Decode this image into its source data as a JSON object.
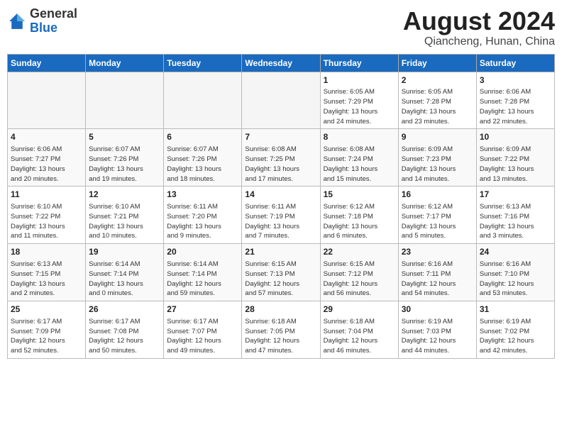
{
  "header": {
    "logo_general": "General",
    "logo_blue": "Blue",
    "title": "August 2024",
    "subtitle": "Qiancheng, Hunan, China"
  },
  "weekdays": [
    "Sunday",
    "Monday",
    "Tuesday",
    "Wednesday",
    "Thursday",
    "Friday",
    "Saturday"
  ],
  "weeks": [
    [
      {
        "day": "",
        "info": ""
      },
      {
        "day": "",
        "info": ""
      },
      {
        "day": "",
        "info": ""
      },
      {
        "day": "",
        "info": ""
      },
      {
        "day": "1",
        "info": "Sunrise: 6:05 AM\nSunset: 7:29 PM\nDaylight: 13 hours\nand 24 minutes."
      },
      {
        "day": "2",
        "info": "Sunrise: 6:05 AM\nSunset: 7:28 PM\nDaylight: 13 hours\nand 23 minutes."
      },
      {
        "day": "3",
        "info": "Sunrise: 6:06 AM\nSunset: 7:28 PM\nDaylight: 13 hours\nand 22 minutes."
      }
    ],
    [
      {
        "day": "4",
        "info": "Sunrise: 6:06 AM\nSunset: 7:27 PM\nDaylight: 13 hours\nand 20 minutes."
      },
      {
        "day": "5",
        "info": "Sunrise: 6:07 AM\nSunset: 7:26 PM\nDaylight: 13 hours\nand 19 minutes."
      },
      {
        "day": "6",
        "info": "Sunrise: 6:07 AM\nSunset: 7:26 PM\nDaylight: 13 hours\nand 18 minutes."
      },
      {
        "day": "7",
        "info": "Sunrise: 6:08 AM\nSunset: 7:25 PM\nDaylight: 13 hours\nand 17 minutes."
      },
      {
        "day": "8",
        "info": "Sunrise: 6:08 AM\nSunset: 7:24 PM\nDaylight: 13 hours\nand 15 minutes."
      },
      {
        "day": "9",
        "info": "Sunrise: 6:09 AM\nSunset: 7:23 PM\nDaylight: 13 hours\nand 14 minutes."
      },
      {
        "day": "10",
        "info": "Sunrise: 6:09 AM\nSunset: 7:22 PM\nDaylight: 13 hours\nand 13 minutes."
      }
    ],
    [
      {
        "day": "11",
        "info": "Sunrise: 6:10 AM\nSunset: 7:22 PM\nDaylight: 13 hours\nand 11 minutes."
      },
      {
        "day": "12",
        "info": "Sunrise: 6:10 AM\nSunset: 7:21 PM\nDaylight: 13 hours\nand 10 minutes."
      },
      {
        "day": "13",
        "info": "Sunrise: 6:11 AM\nSunset: 7:20 PM\nDaylight: 13 hours\nand 9 minutes."
      },
      {
        "day": "14",
        "info": "Sunrise: 6:11 AM\nSunset: 7:19 PM\nDaylight: 13 hours\nand 7 minutes."
      },
      {
        "day": "15",
        "info": "Sunrise: 6:12 AM\nSunset: 7:18 PM\nDaylight: 13 hours\nand 6 minutes."
      },
      {
        "day": "16",
        "info": "Sunrise: 6:12 AM\nSunset: 7:17 PM\nDaylight: 13 hours\nand 5 minutes."
      },
      {
        "day": "17",
        "info": "Sunrise: 6:13 AM\nSunset: 7:16 PM\nDaylight: 13 hours\nand 3 minutes."
      }
    ],
    [
      {
        "day": "18",
        "info": "Sunrise: 6:13 AM\nSunset: 7:15 PM\nDaylight: 13 hours\nand 2 minutes."
      },
      {
        "day": "19",
        "info": "Sunrise: 6:14 AM\nSunset: 7:14 PM\nDaylight: 13 hours\nand 0 minutes."
      },
      {
        "day": "20",
        "info": "Sunrise: 6:14 AM\nSunset: 7:14 PM\nDaylight: 12 hours\nand 59 minutes."
      },
      {
        "day": "21",
        "info": "Sunrise: 6:15 AM\nSunset: 7:13 PM\nDaylight: 12 hours\nand 57 minutes."
      },
      {
        "day": "22",
        "info": "Sunrise: 6:15 AM\nSunset: 7:12 PM\nDaylight: 12 hours\nand 56 minutes."
      },
      {
        "day": "23",
        "info": "Sunrise: 6:16 AM\nSunset: 7:11 PM\nDaylight: 12 hours\nand 54 minutes."
      },
      {
        "day": "24",
        "info": "Sunrise: 6:16 AM\nSunset: 7:10 PM\nDaylight: 12 hours\nand 53 minutes."
      }
    ],
    [
      {
        "day": "25",
        "info": "Sunrise: 6:17 AM\nSunset: 7:09 PM\nDaylight: 12 hours\nand 52 minutes."
      },
      {
        "day": "26",
        "info": "Sunrise: 6:17 AM\nSunset: 7:08 PM\nDaylight: 12 hours\nand 50 minutes."
      },
      {
        "day": "27",
        "info": "Sunrise: 6:17 AM\nSunset: 7:07 PM\nDaylight: 12 hours\nand 49 minutes."
      },
      {
        "day": "28",
        "info": "Sunrise: 6:18 AM\nSunset: 7:05 PM\nDaylight: 12 hours\nand 47 minutes."
      },
      {
        "day": "29",
        "info": "Sunrise: 6:18 AM\nSunset: 7:04 PM\nDaylight: 12 hours\nand 46 minutes."
      },
      {
        "day": "30",
        "info": "Sunrise: 6:19 AM\nSunset: 7:03 PM\nDaylight: 12 hours\nand 44 minutes."
      },
      {
        "day": "31",
        "info": "Sunrise: 6:19 AM\nSunset: 7:02 PM\nDaylight: 12 hours\nand 42 minutes."
      }
    ]
  ]
}
